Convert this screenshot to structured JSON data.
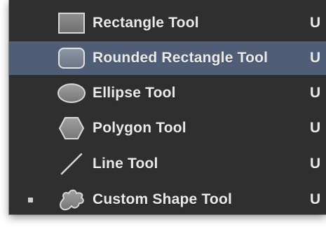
{
  "menu": {
    "items": [
      {
        "label": "Rectangle Tool",
        "shortcut": "U",
        "icon": "rectangle-icon",
        "highlighted": false,
        "active": false
      },
      {
        "label": "Rounded Rectangle Tool",
        "shortcut": "U",
        "icon": "rounded-rectangle-icon",
        "highlighted": true,
        "active": false
      },
      {
        "label": "Ellipse Tool",
        "shortcut": "U",
        "icon": "ellipse-icon",
        "highlighted": false,
        "active": false
      },
      {
        "label": "Polygon Tool",
        "shortcut": "U",
        "icon": "polygon-icon",
        "highlighted": false,
        "active": false
      },
      {
        "label": "Line Tool",
        "shortcut": "U",
        "icon": "line-icon",
        "highlighted": false,
        "active": false
      },
      {
        "label": "Custom Shape Tool",
        "shortcut": "U",
        "icon": "custom-shape-icon",
        "highlighted": false,
        "active": true
      }
    ]
  },
  "colors": {
    "menu_background": "#2f2f2f",
    "highlight": "#4f5d76",
    "text": "#eaeaea",
    "icon_fill": "#8e8e8e"
  }
}
